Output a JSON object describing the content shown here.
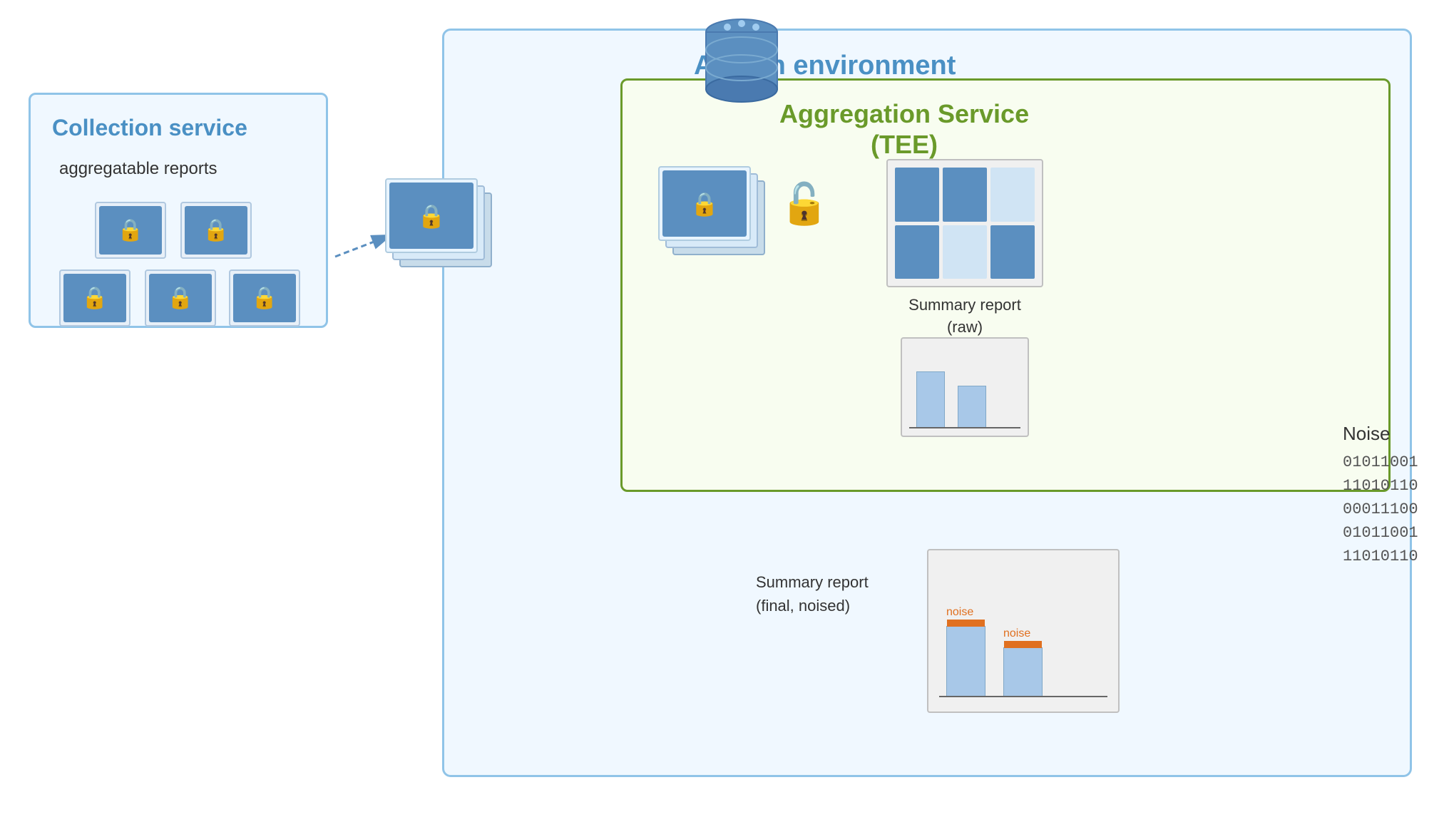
{
  "adtech": {
    "label": "Adtech environment",
    "aggregation_service": {
      "title_line1": "Aggregation Service",
      "title_line2": "(TEE)"
    }
  },
  "collection_service": {
    "label": "Collection service",
    "sublabel": "aggregatable reports"
  },
  "noise": {
    "title": "Noise",
    "binary_lines": [
      "01011001",
      "11010110",
      "00011100",
      "01011001",
      "11010110"
    ]
  },
  "summary_raw": {
    "label_line1": "Summary report",
    "label_line2": "(raw)"
  },
  "summary_final": {
    "label_line1": "Summary report",
    "label_line2": "(final, noised)"
  },
  "noise_label": "noise",
  "plus_symbol": "+"
}
